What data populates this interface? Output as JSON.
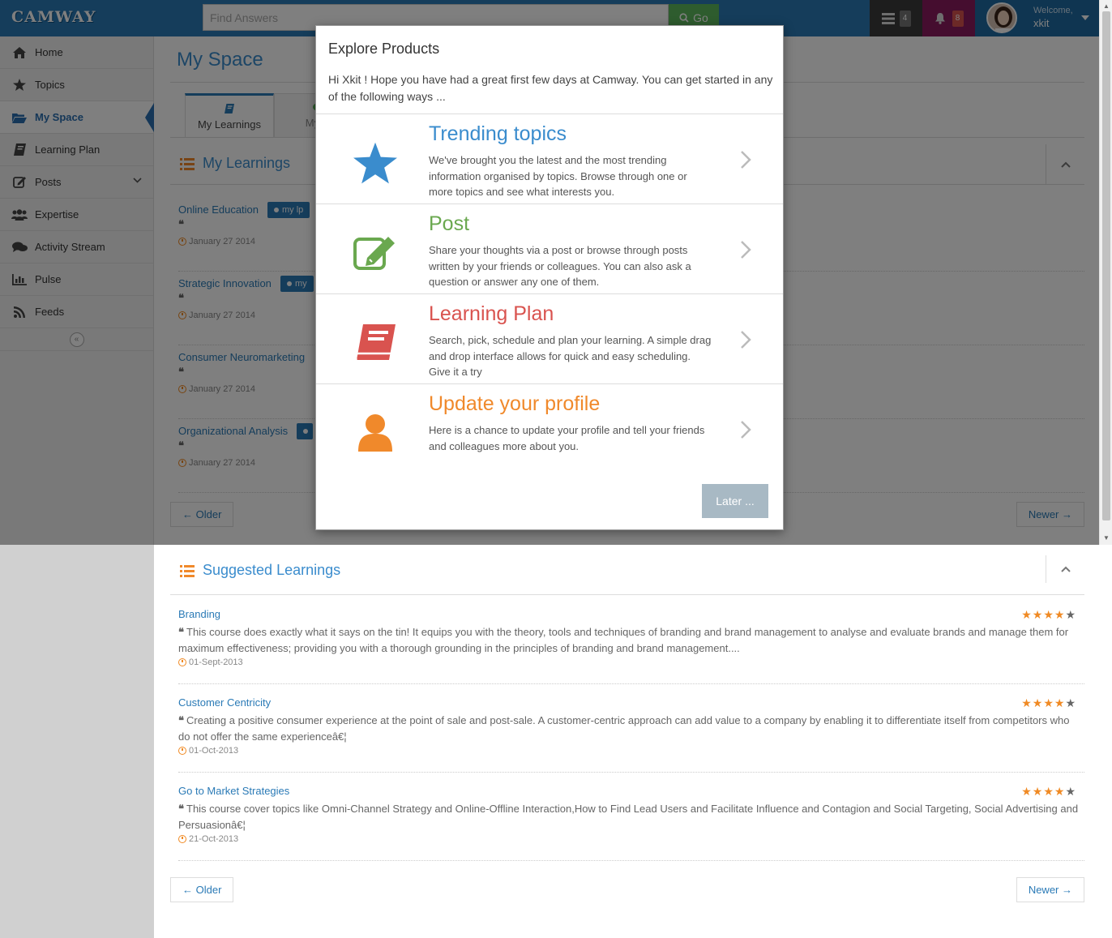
{
  "header": {
    "logo": "CAMWAY",
    "search_placeholder": "Find Answers",
    "go_label": "Go",
    "tasks_count": "4",
    "notifications_count": "8",
    "welcome_label": "Welcome,",
    "username": "xkit"
  },
  "sidebar": {
    "items": [
      {
        "label": "Home",
        "icon": "home-icon"
      },
      {
        "label": "Topics",
        "icon": "star-icon"
      },
      {
        "label": "My Space",
        "icon": "folder-open-icon",
        "active": true
      },
      {
        "label": "Learning Plan",
        "icon": "book-icon"
      },
      {
        "label": "Posts",
        "icon": "edit-icon"
      },
      {
        "label": "Expertise",
        "icon": "users-icon"
      },
      {
        "label": "Activity Stream",
        "icon": "comments-icon"
      },
      {
        "label": "Pulse",
        "icon": "bar-chart-icon"
      },
      {
        "label": "Feeds",
        "icon": "rss-icon"
      }
    ]
  },
  "main": {
    "page_title": "My Space",
    "tabs": [
      {
        "label": "My Learnings"
      },
      {
        "label": "My Bl"
      }
    ],
    "my_learnings": {
      "title": "My Learnings",
      "items": [
        {
          "title": "Online Education",
          "tag": "my lp",
          "date": "January 27 2014"
        },
        {
          "title": "Strategic Innovation",
          "tag": "my",
          "date": "January 27 2014"
        },
        {
          "title": "Consumer Neuromarketing",
          "tag": "",
          "date": "January 27 2014"
        },
        {
          "title": "Organizational Analysis",
          "tag": "",
          "date": "January 27 2014"
        }
      ],
      "older": "← Older",
      "newer": "Newer →"
    },
    "suggested": {
      "title": "Suggested Learnings",
      "items": [
        {
          "title": "Branding",
          "rating": 4,
          "description": "This course does exactly what it says on the tin! It equips you with the theory, tools and techniques of branding and brand management to analyse and evaluate brands and manage them for maximum effectiveness; providing you with a thorough grounding in the principles of branding and brand management....",
          "date": "01-Sept-2013"
        },
        {
          "title": "Customer Centricity",
          "rating": 4,
          "description": "Creating a positive consumer experience at the point of sale and post-sale. A customer-centric approach can add value to a company by enabling it to differentiate itself from competitors who do not offer the same experienceâ€¦",
          "date": "01-Oct-2013"
        },
        {
          "title": "Go to Market Strategies",
          "rating": 4,
          "description": "This course cover topics like Omni-Channel Strategy and Online-Offline Interaction,How to Find Lead Users and Facilitate Influence and Contagion and Social Targeting, Social Advertising and Persuasionâ€¦",
          "date": "21-Oct-2013"
        }
      ],
      "older": "← Older",
      "newer": "Newer →"
    }
  },
  "modal": {
    "title": "Explore Products",
    "intro": "Hi Xkit ! Hope you have had a great first few days at Camway. You can get started in any of the following ways ...",
    "options": [
      {
        "title": "Trending topics",
        "description": "We've brought you the latest and the most trending information organised by topics. Browse through one or more topics and see what interests you.",
        "color": "#3a8ccd",
        "icon": "star-icon"
      },
      {
        "title": "Post",
        "description": "Share your thoughts via a post or browse through posts written by your friends or colleagues. You can also ask a question or answer any one of them.",
        "color": "#6aa84f",
        "icon": "edit-icon"
      },
      {
        "title": "Learning Plan",
        "description": "Search, pick, schedule and plan your learning. A simple drag and drop interface allows for quick and easy scheduling. Give it a try",
        "color": "#d9534f",
        "icon": "book-icon"
      },
      {
        "title": "Update your profile",
        "description": "Here is a chance to update your profile and tell your friends and colleagues more about you.",
        "color": "#f0892b",
        "icon": "user-icon"
      }
    ],
    "later_label": "Later ..."
  }
}
